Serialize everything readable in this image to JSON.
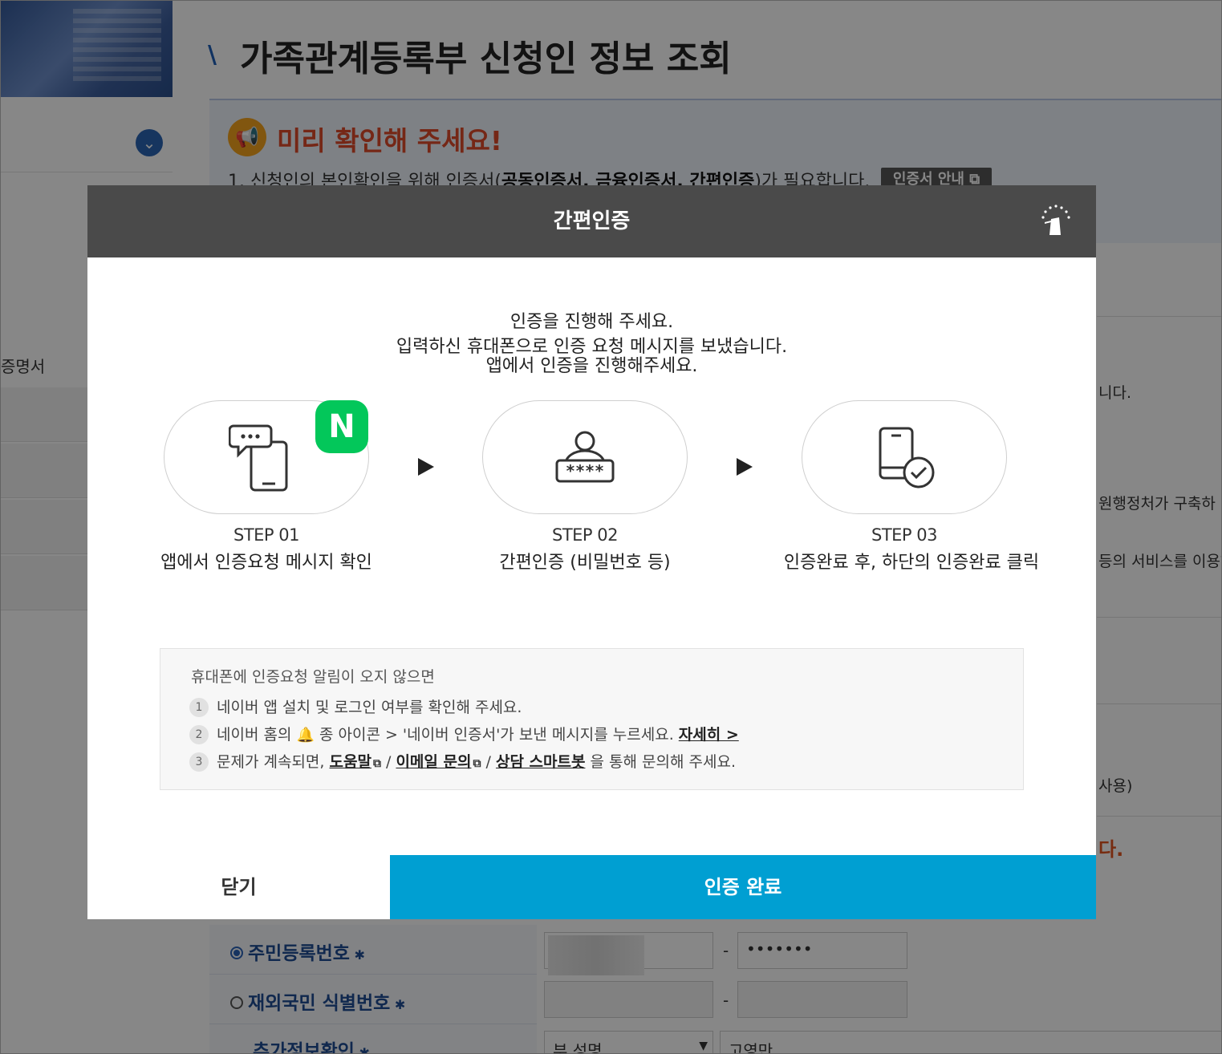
{
  "page": {
    "title": "가족관계등록부 신청인 정보 조회",
    "sidebar_partial_text": "증명서",
    "notice": {
      "title": "미리 확인해 주세요!",
      "line_prefix": "1. 신청인의 본인확인을 위해 인증서(",
      "line_bold": "공동인증서, 금융인증서, 간편인증",
      "line_suffix": ")가 필요합니다.",
      "cert_button": "인증서 안내"
    },
    "right_partial_texts": [
      "니다.",
      "원행정처가 구축하",
      "등의 서비스를 이용하",
      "사용)",
      "다."
    ],
    "form": {
      "rrn_label": "주민등록번호",
      "foreign_label": "재외국민 식별번호",
      "extra_label": "추가정보확인",
      "rrn_masked": "•••••••",
      "dash": "-",
      "relation_select": "부 성명",
      "name_value": "고영만"
    }
  },
  "modal": {
    "title": "간편인증",
    "message_line1": "인증을 진행해 주세요.",
    "message_line2": "입력하신 휴대폰으로 인증 요청 메시지를 보냈습니다.",
    "message_line3": "앱에서 인증을 진행해주세요.",
    "naver_badge": "N",
    "steps": [
      {
        "num": "STEP 01",
        "desc": "앱에서 인증요청 메시지 확인"
      },
      {
        "num": "STEP 02",
        "desc": "간편인증 (비밀번호 등)"
      },
      {
        "num": "STEP 03",
        "desc": "인증완료 후, 하단의 인증완료 클릭"
      }
    ],
    "step2_code": "****",
    "help": {
      "title": "휴대폰에 인증요청 알림이 오지 않으면",
      "item1_num": "1",
      "item1": "네이버 앱 설치 및 로그인 여부를 확인해 주세요.",
      "item2_num": "2",
      "item2_prefix": "네이버 홈의",
      "item2_middle": "종 아이콘 > '네이버 인증서'가 보낸 메시지를 누르세요.",
      "item2_link": "자세히 >",
      "item3_num": "3",
      "item3_prefix": "문제가 계속되면,",
      "item3_link1": "도움말",
      "item3_sep1": "/",
      "item3_link2": "이메일 문의",
      "item3_sep2": "/",
      "item3_link3": "상담 스마트봇",
      "item3_suffix": "을 통해 문의해 주세요."
    },
    "close_button": "닫기",
    "done_button": "인증 완료"
  },
  "colors": {
    "header_bg": "#4a4a4a",
    "done_button_bg": "#009fd2",
    "naver_green": "#03c75a",
    "notice_title": "#de4b2a"
  },
  "icons": [
    "chevron-down-icon",
    "megaphone-icon",
    "external-link-icon",
    "court-logo-icon",
    "chat-phone-icon",
    "user-password-icon",
    "phone-check-icon",
    "play-arrow-icon",
    "bell-icon"
  ]
}
